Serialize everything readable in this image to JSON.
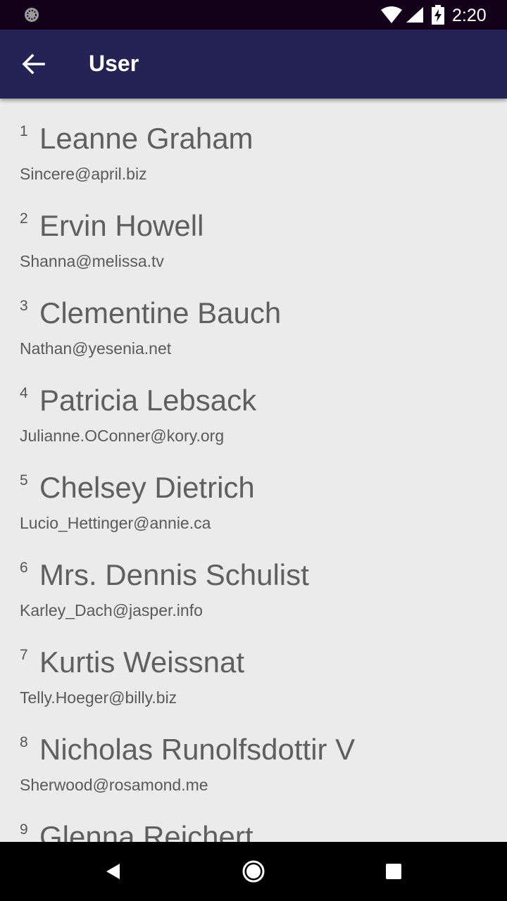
{
  "status_bar": {
    "time": "2:20",
    "icons": [
      "notification-icon",
      "wifi-icon",
      "signal-icon",
      "battery-charging-icon"
    ]
  },
  "app_bar": {
    "title": "User",
    "back_icon": "arrow-back-icon"
  },
  "users": [
    {
      "id": "1",
      "name": "Leanne Graham",
      "email": "Sincere@april.biz"
    },
    {
      "id": "2",
      "name": "Ervin Howell",
      "email": "Shanna@melissa.tv"
    },
    {
      "id": "3",
      "name": "Clementine Bauch",
      "email": "Nathan@yesenia.net"
    },
    {
      "id": "4",
      "name": "Patricia Lebsack",
      "email": "Julianne.OConner@kory.org"
    },
    {
      "id": "5",
      "name": "Chelsey Dietrich",
      "email": "Lucio_Hettinger@annie.ca"
    },
    {
      "id": "6",
      "name": "Mrs. Dennis Schulist",
      "email": "Karley_Dach@jasper.info"
    },
    {
      "id": "7",
      "name": "Kurtis Weissnat",
      "email": "Telly.Hoeger@billy.biz"
    },
    {
      "id": "8",
      "name": "Nicholas Runolfsdottir V",
      "email": "Sherwood@rosamond.me"
    },
    {
      "id": "9",
      "name": "Glenna Reichert",
      "email": ""
    }
  ],
  "nav_bar": {
    "icons": [
      "back-triangle-icon",
      "home-circle-icon",
      "recents-square-icon"
    ]
  },
  "colors": {
    "app_bar": "#232454",
    "status_bar": "#14021a",
    "background": "#ebebeb"
  }
}
